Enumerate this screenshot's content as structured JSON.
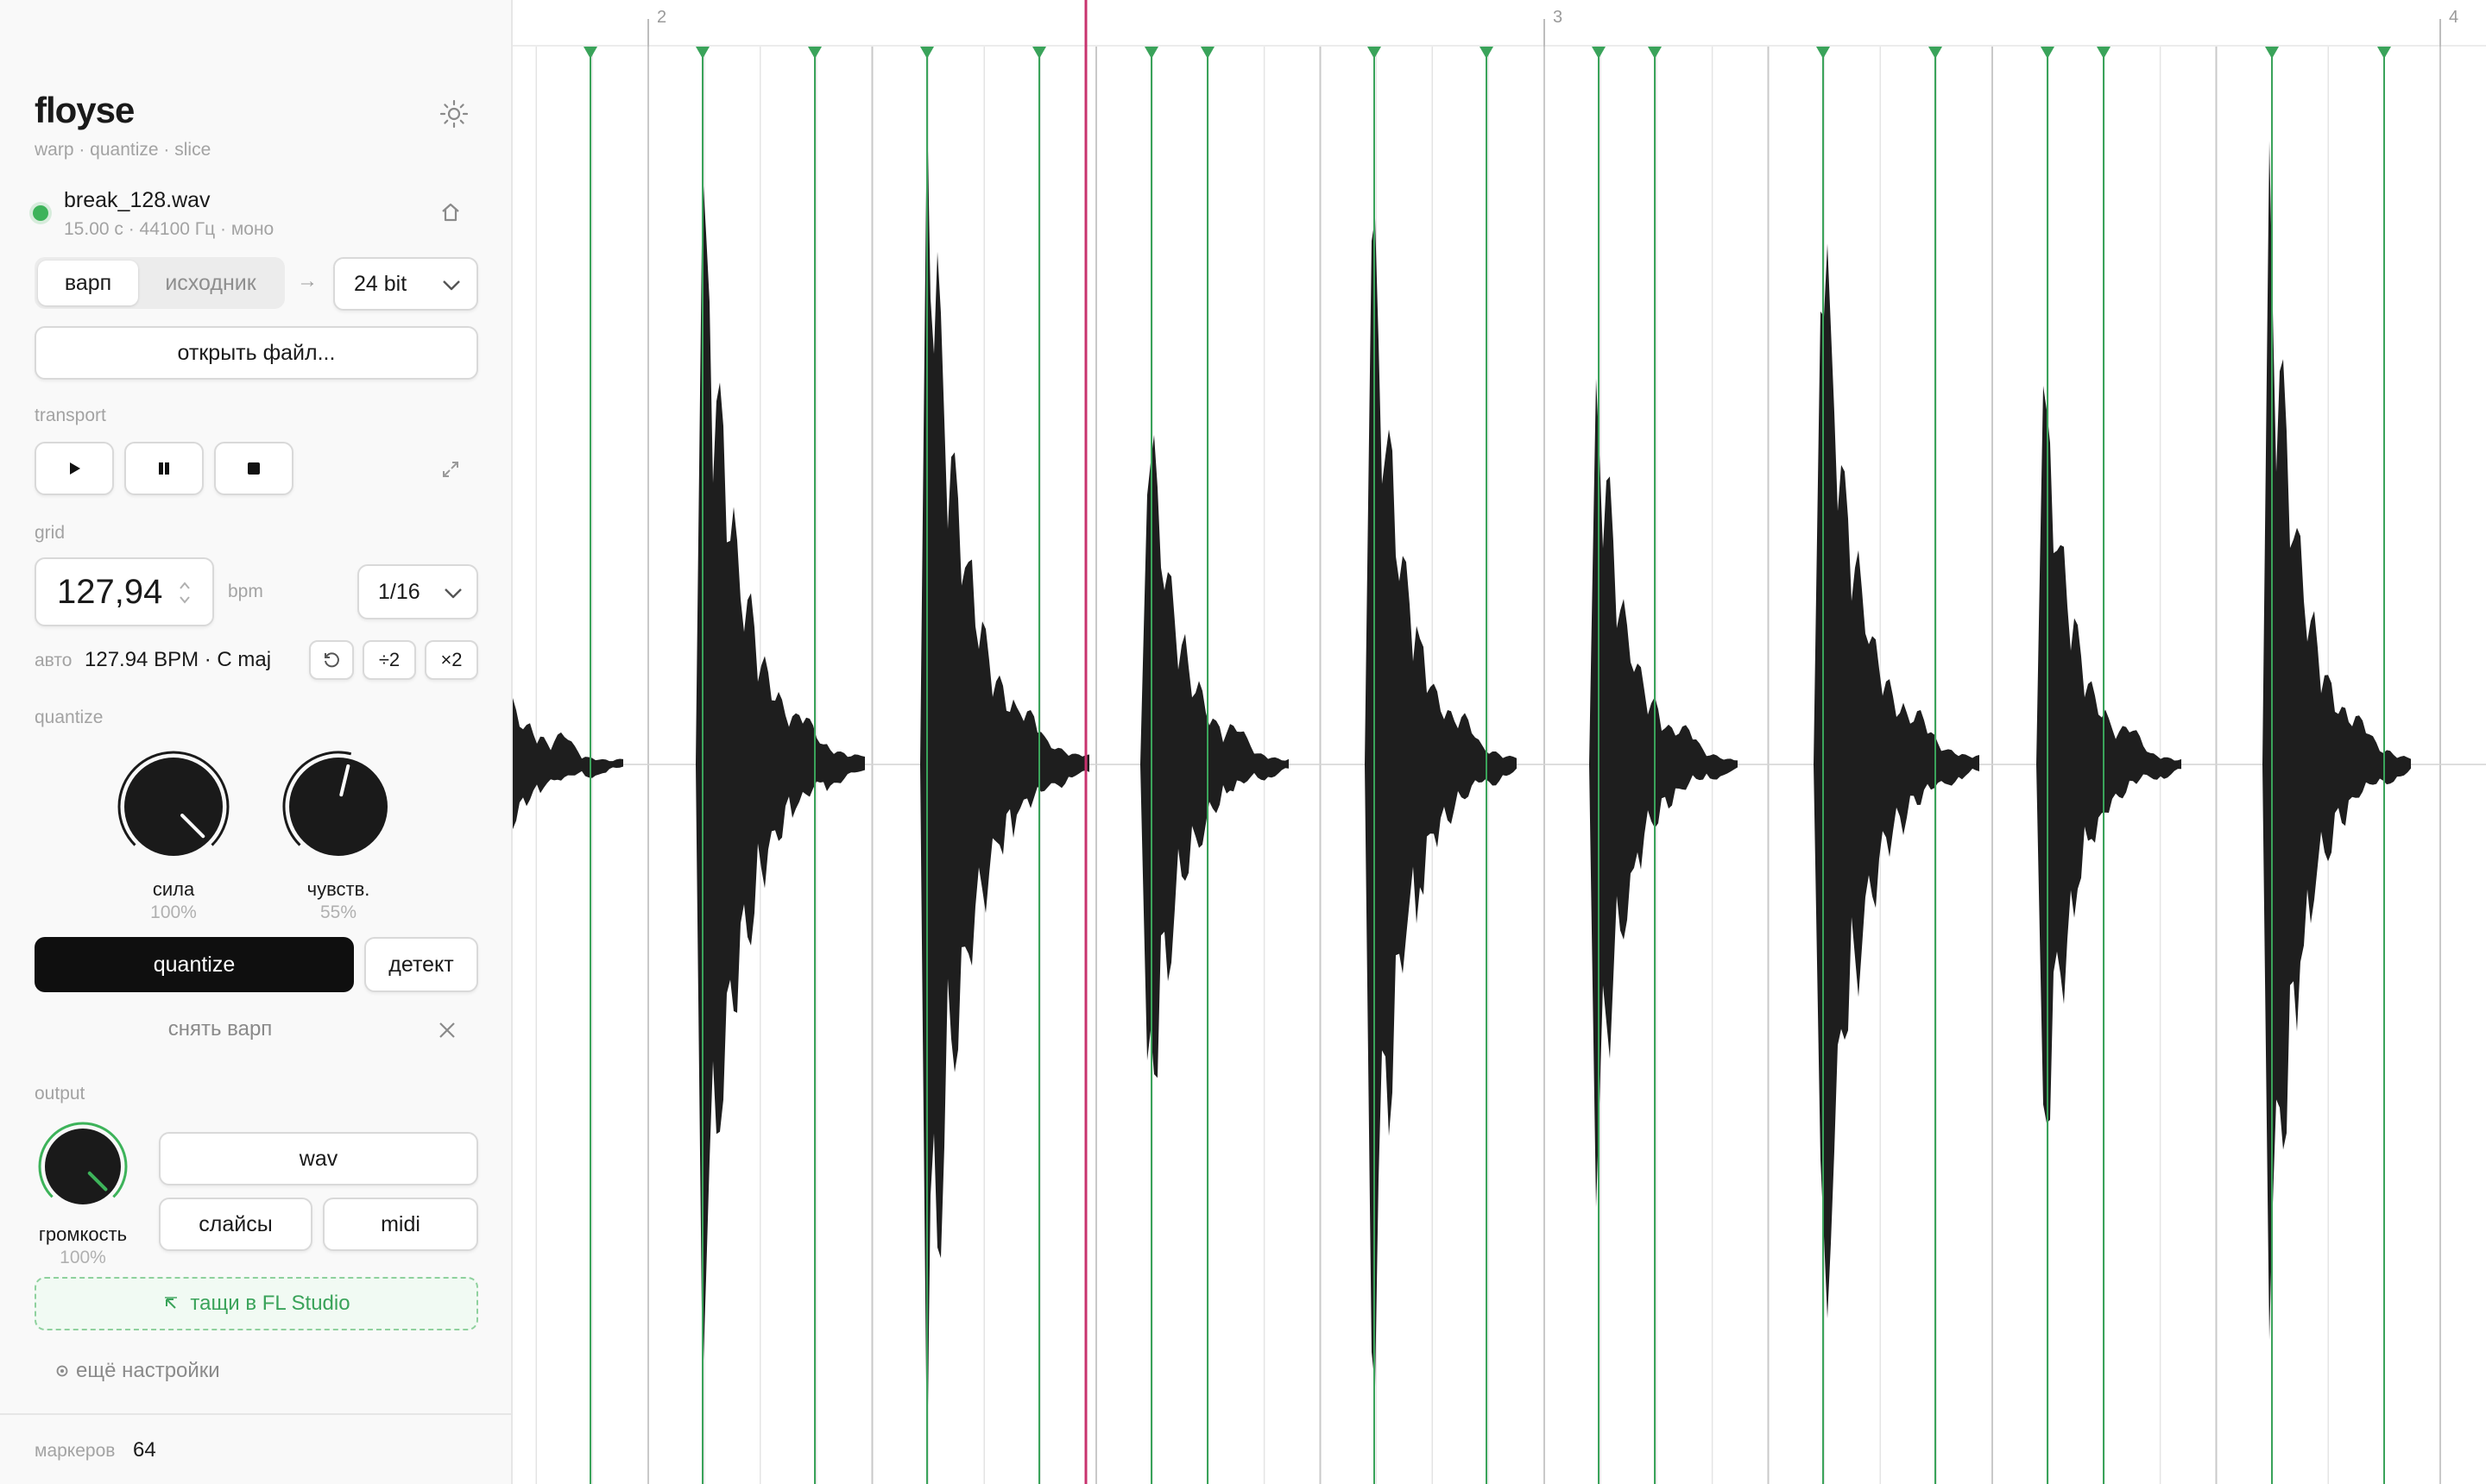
{
  "app": {
    "title": "floyse",
    "subtitle": "warp · quantize · slice",
    "theme_icon": "sun-icon"
  },
  "file": {
    "name": "break_128.wav",
    "meta": "15.00 с · 44100 Гц · моно",
    "status_color": "#3db35a",
    "home_icon": "home-icon"
  },
  "view_mode": {
    "options": [
      "варп",
      "исходник"
    ],
    "selected": "варп",
    "arrow": "→",
    "bit_depth": "24 bit"
  },
  "open_file_label": "открыть файл...",
  "transport": {
    "label": "transport",
    "play_icon": "play-icon",
    "pause_icon": "pause-icon",
    "stop_icon": "stop-icon",
    "expand_icon": "expand-icon"
  },
  "grid": {
    "label": "grid",
    "bpm_value": "127,94",
    "bpm_unit": "bpm",
    "division": "1/16",
    "auto_label": "авто",
    "auto_value": "127.94 BPM · C maj",
    "reset_icon": "reset-icon",
    "half_label": "÷2",
    "double_label": "×2"
  },
  "quantize": {
    "label": "quantize",
    "strength_label": "сила",
    "strength_value": "100%",
    "strength_fraction": 1.0,
    "sensitivity_label": "чувств.",
    "sensitivity_value": "55%",
    "sensitivity_fraction": 0.55,
    "quantize_button": "quantize",
    "detect_button": "детект",
    "unwarp_label": "снять варп",
    "close_icon": "close-icon"
  },
  "output": {
    "label": "output",
    "volume_label": "громкость",
    "volume_value": "100%",
    "volume_fraction": 1.0,
    "wav_button": "wav",
    "slices_button": "слайсы",
    "midi_button": "midi",
    "drag_icon": "drag-out-icon",
    "drag_label": "тащи в FL Studio",
    "more_icon": "gear-icon",
    "more_label": "ещё настройки"
  },
  "footer": {
    "markers_label": "маркеров",
    "markers_count": "64"
  },
  "timeline": {
    "bar_labels": [
      "2",
      "3",
      "4"
    ],
    "colors": {
      "marker": "#3aa35a",
      "playhead": "#c8326e",
      "waveform": "#1e1e1e",
      "grid": "#e4e4e4",
      "beat": "#c9c9c9"
    }
  }
}
